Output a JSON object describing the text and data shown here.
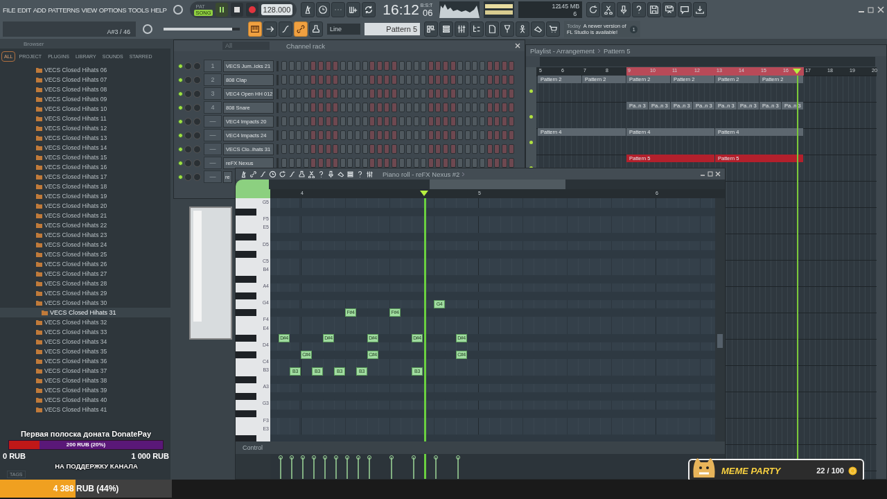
{
  "menu": [
    "FILE",
    "EDIT",
    "ADD",
    "PATTERNS",
    "VIEW",
    "OPTIONS",
    "TOOLS",
    "HELP"
  ],
  "transport": {
    "modes": [
      {
        "label": "PAT",
        "selected": false
      },
      {
        "label": "SONG",
        "selected": true
      }
    ],
    "playing": true,
    "tempo": "128.000"
  },
  "clock": {
    "time": "16:12",
    "seconds": "06",
    "format": "B:S:T"
  },
  "monitor": {
    "voices": "12",
    "memory": "145 MB",
    "cpu": "6"
  },
  "hint_bar": {
    "text": "A#3 / 46"
  },
  "master_volume": {
    "level": 0.9
  },
  "record_buttons": [
    {
      "on": true
    },
    {
      "on": false
    },
    {
      "on": false
    },
    {
      "on": true
    },
    {
      "on": false
    }
  ],
  "snap": {
    "value": "Line"
  },
  "pattern_selector": {
    "value": "Pattern 5"
  },
  "news": {
    "day": "Today",
    "text": "A newer version of FL Studio is available!",
    "count": "1"
  },
  "browser": {
    "title": "Browser",
    "tags": "TAGS",
    "tabs": [
      {
        "label": "ALL",
        "selected": true
      },
      {
        "label": "PROJECT",
        "selected": false
      },
      {
        "label": "PLUGINS",
        "selected": false
      },
      {
        "label": "LIBRARY",
        "selected": false
      },
      {
        "label": "SOUNDS",
        "selected": false
      },
      {
        "label": "STARRED",
        "selected": false
      }
    ],
    "items": [
      {
        "label": "VECS Closed Hihats 06",
        "selected": false
      },
      {
        "label": "VECS Closed Hihats 07",
        "selected": false
      },
      {
        "label": "VECS Closed Hihats 08",
        "selected": false
      },
      {
        "label": "VECS Closed Hihats 09",
        "selected": false
      },
      {
        "label": "VECS Closed Hihats 10",
        "selected": false
      },
      {
        "label": "VECS Closed Hihats 11",
        "selected": false
      },
      {
        "label": "VECS Closed Hihats 12",
        "selected": false
      },
      {
        "label": "VECS Closed Hihats 13",
        "selected": false
      },
      {
        "label": "VECS Closed Hihats 14",
        "selected": false
      },
      {
        "label": "VECS Closed Hihats 15",
        "selected": false
      },
      {
        "label": "VECS Closed Hihats 16",
        "selected": false
      },
      {
        "label": "VECS Closed Hihats 17",
        "selected": false
      },
      {
        "label": "VECS Closed Hihats 18",
        "selected": false
      },
      {
        "label": "VECS Closed Hihats 19",
        "selected": false
      },
      {
        "label": "VECS Closed Hihats 20",
        "selected": false
      },
      {
        "label": "VECS Closed Hihats 21",
        "selected": false
      },
      {
        "label": "VECS Closed Hihats 22",
        "selected": false
      },
      {
        "label": "VECS Closed Hihats 23",
        "selected": false
      },
      {
        "label": "VECS Closed Hihats 24",
        "selected": false
      },
      {
        "label": "VECS Closed Hihats 25",
        "selected": false
      },
      {
        "label": "VECS Closed Hihats 26",
        "selected": false
      },
      {
        "label": "VECS Closed Hihats 27",
        "selected": false
      },
      {
        "label": "VECS Closed Hihats 28",
        "selected": false
      },
      {
        "label": "VECS Closed Hihats 29",
        "selected": false
      },
      {
        "label": "VECS Closed Hihats 30",
        "selected": false
      },
      {
        "label": "VECS Closed Hihats 31",
        "selected": true
      },
      {
        "label": "VECS Closed Hihats 32",
        "selected": false
      },
      {
        "label": "VECS Closed Hihats 33",
        "selected": false
      },
      {
        "label": "VECS Closed Hihats 34",
        "selected": false
      },
      {
        "label": "VECS Closed Hihats 35",
        "selected": false
      },
      {
        "label": "VECS Closed Hihats 36",
        "selected": false
      },
      {
        "label": "VECS Closed Hihats 37",
        "selected": false
      },
      {
        "label": "VECS Closed Hihats 38",
        "selected": false
      },
      {
        "label": "VECS Closed Hihats 39",
        "selected": false
      },
      {
        "label": "VECS Closed Hihats 40",
        "selected": false
      },
      {
        "label": "VECS Closed Hihats 41",
        "selected": false
      }
    ]
  },
  "channel_rack": {
    "filter": "All",
    "title": "Channel rack",
    "channels": [
      {
        "number": "1",
        "name": "VECS Jum..icks 21"
      },
      {
        "number": "2",
        "name": "808 Clap"
      },
      {
        "number": "3",
        "name": "VEC4 Open HH 012"
      },
      {
        "number": "4",
        "name": "808 Snare"
      },
      {
        "number": "—",
        "name": "VEC4 Impacts 20"
      },
      {
        "number": "—",
        "name": "VEC4 Impacts 24"
      },
      {
        "number": "—",
        "name": "VECS Clo..ihats 31"
      },
      {
        "number": "—",
        "name": "reFX Nexus"
      },
      {
        "number": "—",
        "name": "re"
      }
    ]
  },
  "playlist": {
    "title": "Playlist - Arrangement",
    "pattern": "Pattern 5",
    "ruler": [
      "5",
      "6",
      "7",
      "8",
      "9",
      "10",
      "11",
      "12",
      "13",
      "14",
      "15",
      "16",
      "17",
      "18",
      "19",
      "20"
    ],
    "tracks": [
      {
        "clips": [
          {
            "label": "Pattern 2",
            "color": "#5d676f"
          },
          {
            "label": "Pattern 2",
            "color": "#5d676f"
          },
          {
            "label": "Pattern 2",
            "color": "#5d676f"
          },
          {
            "label": "Pattern 2",
            "color": "#5d676f"
          },
          {
            "label": "Pattern 2",
            "color": "#5d676f"
          },
          {
            "label": "Pattern 2",
            "color": "#5d676f"
          }
        ]
      },
      {
        "clips": [
          {
            "label": "Pa..n 3",
            "color": "#5d676f"
          },
          {
            "label": "Pa..n 3",
            "color": "#5d676f"
          },
          {
            "label": "Pa..n 3",
            "color": "#5d676f"
          },
          {
            "label": "Pa..n 3",
            "color": "#5d676f"
          },
          {
            "label": "Pa..n 3",
            "color": "#5d676f"
          },
          {
            "label": "Pa..n 3",
            "color": "#5d676f"
          },
          {
            "label": "Pa..n 3",
            "color": "#5d676f"
          },
          {
            "label": "Pa..n 3",
            "color": "#5d676f"
          }
        ]
      },
      {
        "clips": [
          {
            "label": "Pattern 4",
            "color": "#5d676f"
          },
          {
            "label": "Pattern 4",
            "color": "#5d676f"
          },
          {
            "label": "Pattern 4",
            "color": "#5d676f"
          }
        ]
      },
      {
        "clips": [
          {
            "label": "Pattern 5",
            "color": "#b3202c"
          },
          {
            "label": "Pattern 5",
            "color": "#b3202c"
          }
        ]
      }
    ]
  },
  "piano_roll": {
    "title": "Piano roll - reFX Nexus #2",
    "ruler": [
      "4",
      "5",
      "6"
    ],
    "control_label": "Control",
    "keys": [
      "G5",
      "F5",
      "E5",
      "D5",
      "C5",
      "B4",
      "A4",
      "G4",
      "F4",
      "E4",
      "D4",
      "C4",
      "B3",
      "A3",
      "G3",
      "F3",
      "E3"
    ],
    "notes": [
      {
        "label": "D#4"
      },
      {
        "label": "B3"
      },
      {
        "label": "C#4"
      },
      {
        "label": "B3"
      },
      {
        "label": "D#4"
      },
      {
        "label": "B3"
      },
      {
        "label": "F#4"
      },
      {
        "label": "B3"
      },
      {
        "label": "D#4"
      },
      {
        "label": "C#4"
      },
      {
        "label": "F#4"
      },
      {
        "label": "D#4"
      },
      {
        "label": "B3"
      },
      {
        "label": "G4"
      },
      {
        "label": "D#4"
      },
      {
        "label": "C#4"
      }
    ]
  },
  "donation": {
    "title": "Первая полоска доната DonatePay",
    "reading": "200 RUB (20%)",
    "level": 0.2,
    "min": "0 RUB",
    "max": "1 000 RUB",
    "caption": "НА ПОДДЕРЖКУ КАНАЛА",
    "total": {
      "reading": "4 388 RUB (44%)",
      "level": 0.44
    }
  },
  "meme_party": {
    "title": "MEME PARTY",
    "count": "22 / 100"
  }
}
